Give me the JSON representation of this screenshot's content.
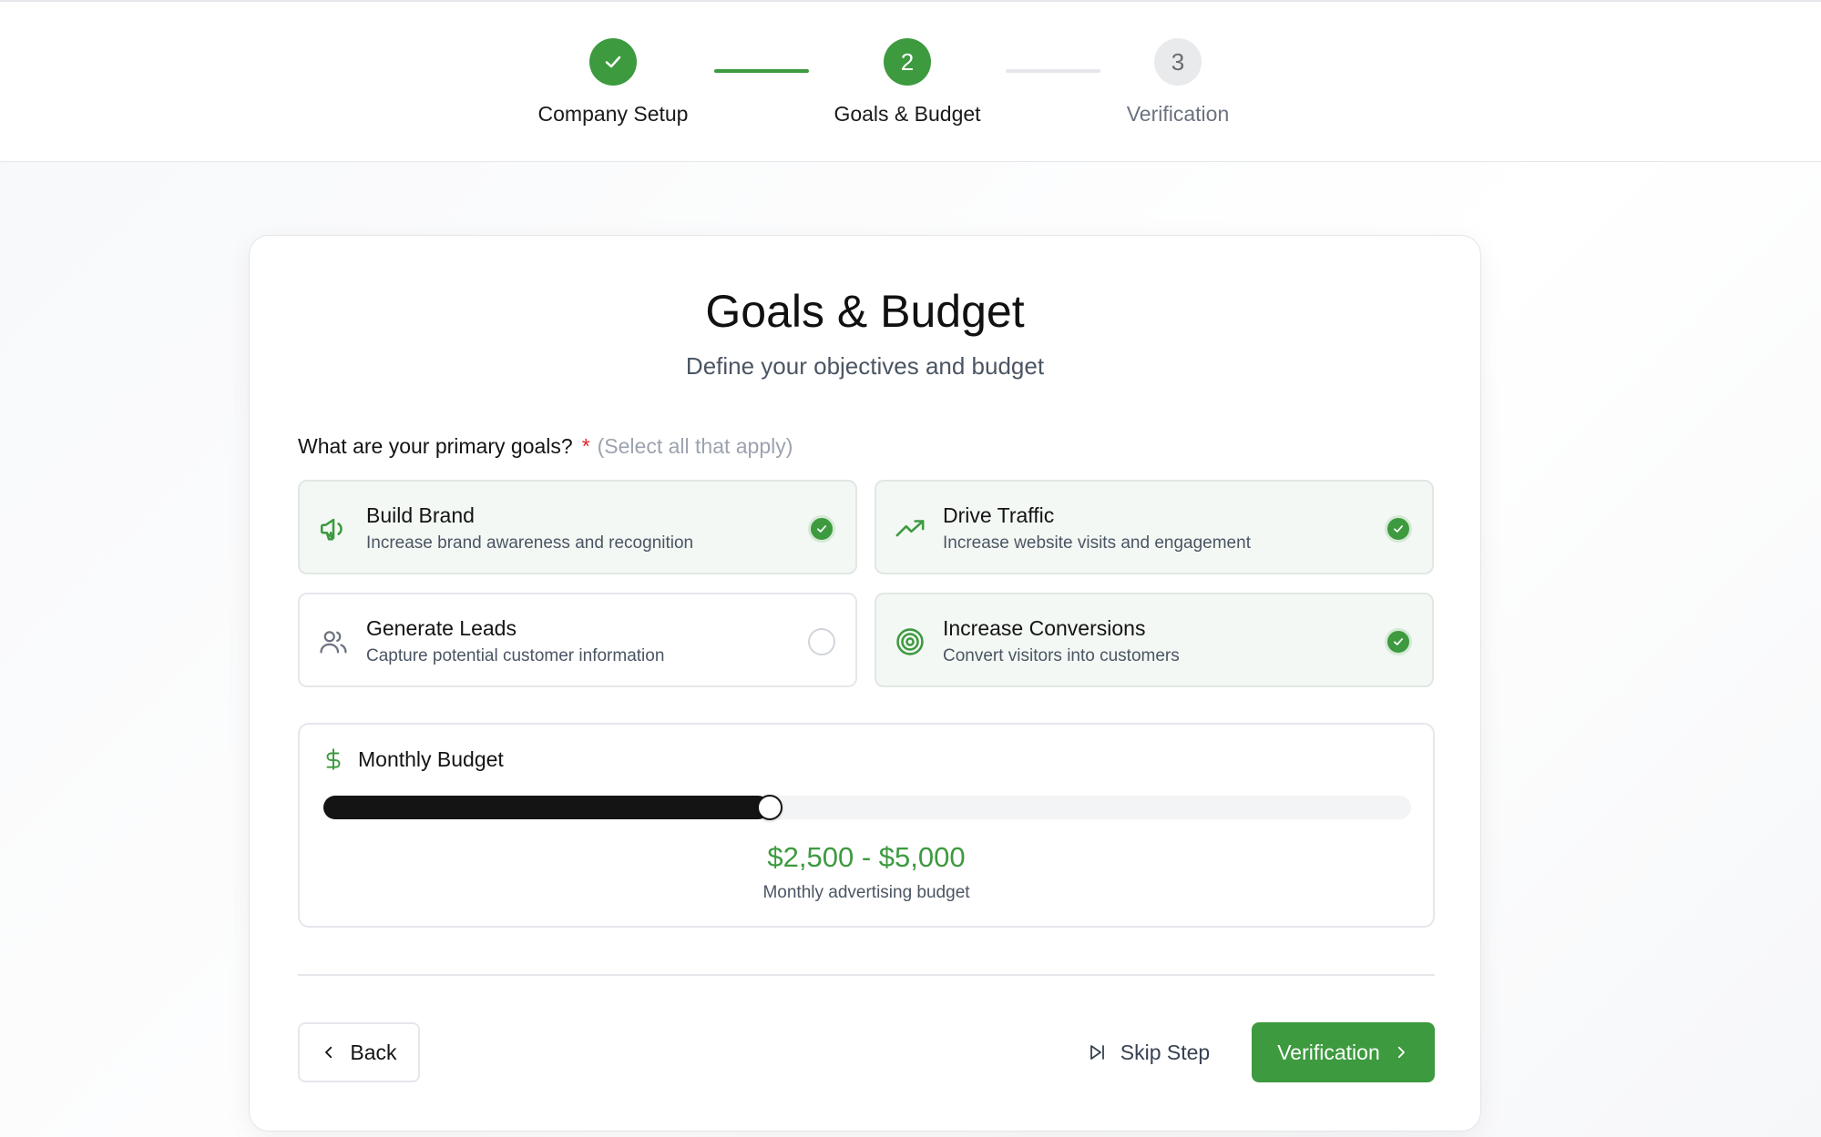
{
  "stepper": {
    "steps": [
      {
        "number": "1",
        "label": "Company Setup",
        "status": "completed",
        "icon": "check-icon"
      },
      {
        "number": "2",
        "label": "Goals & Budget",
        "status": "active"
      },
      {
        "number": "3",
        "label": "Verification",
        "status": "upcoming"
      }
    ]
  },
  "card": {
    "title": "Goals & Budget",
    "subtitle": "Define your objectives and budget"
  },
  "goals": {
    "question": "What are your primary goals?",
    "required_mark": "*",
    "hint": "(Select all that apply)",
    "options": [
      {
        "title": "Build Brand",
        "description": "Increase brand awareness and recognition",
        "icon": "megaphone-icon",
        "selected": true
      },
      {
        "title": "Drive Traffic",
        "description": "Increase website visits and engagement",
        "icon": "trending-up-icon",
        "selected": true
      },
      {
        "title": "Generate Leads",
        "description": "Capture potential customer information",
        "icon": "users-icon",
        "selected": false
      },
      {
        "title": "Increase Conversions",
        "description": "Convert visitors into customers",
        "icon": "target-icon",
        "selected": true
      }
    ]
  },
  "budget": {
    "label": "Monthly Budget",
    "icon": "dollar-icon",
    "slider_level": 0.41,
    "range_text": "$2,500 - $5,000",
    "caption": "Monthly advertising budget"
  },
  "actions": {
    "back_label": "Back",
    "skip_label": "Skip Step",
    "next_label": "Verification"
  },
  "colors": {
    "accent": "#3d9a3f",
    "selected_bg": "#f3f8f4",
    "required": "#dc2626",
    "slider_fill": "#141414"
  }
}
